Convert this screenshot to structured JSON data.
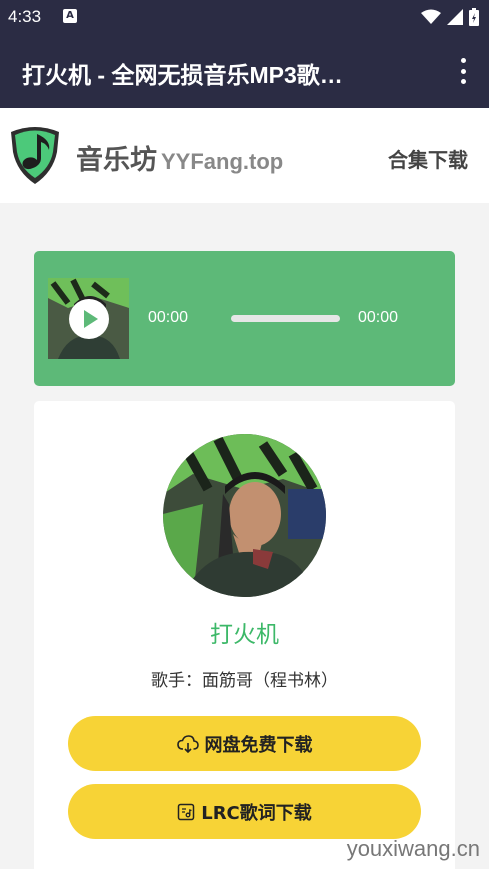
{
  "status_bar": {
    "time": "4:33",
    "notification_icon": "A"
  },
  "app_bar": {
    "title": "打火机 - 全网无损音乐MP3歌…"
  },
  "site": {
    "name": "音乐坊",
    "domain": "YYFang.top",
    "nav_link": "合集下载"
  },
  "player": {
    "current_time": "00:00",
    "duration": "00:00",
    "progress": 0
  },
  "song": {
    "title": "打火机",
    "singer": "歌手：面筋哥（程书林）"
  },
  "buttons": {
    "download": "网盘免费下载",
    "lyrics": "LRC歌词下载"
  },
  "watermark": "youxiwang.cn",
  "colors": {
    "accent_green": "#5db978",
    "button_yellow": "#f7d336",
    "app_bar": "#2b2c44",
    "title_green": "#3cb868"
  }
}
